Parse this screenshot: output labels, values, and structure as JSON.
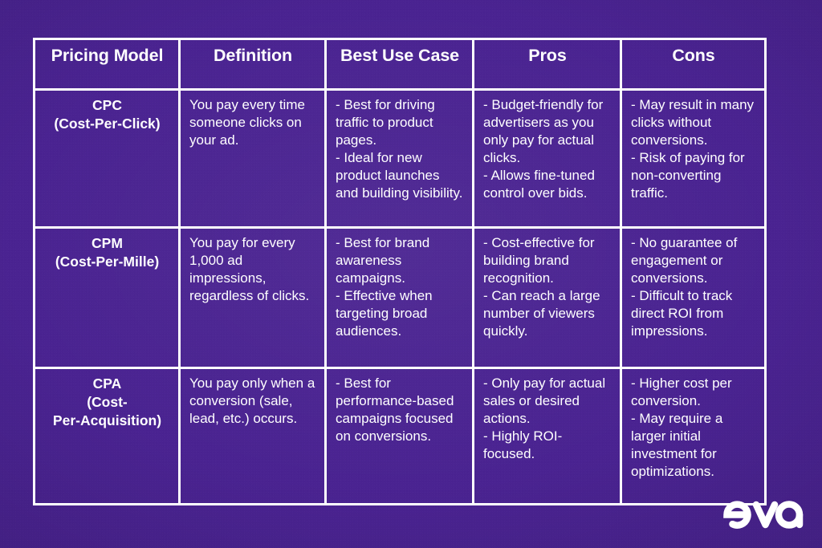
{
  "page": {
    "background_color": "#4a2391",
    "text_color": "#ffffff",
    "border_color": "#ffffff"
  },
  "table": {
    "headers": [
      "Pricing Model",
      "Definition",
      "Best Use Case",
      "Pros",
      "Cons"
    ],
    "rows": [
      {
        "model": "CPC\n(Cost-Per-Click)",
        "definition": "You pay every time someone clicks on your ad.",
        "best_use_case": "- Best for driving traffic to product pages.\n- Ideal for new product launches and building visibility.",
        "pros": "- Budget-friendly for advertisers as you only pay for actual clicks.\n- Allows fine-tuned control over bids.",
        "cons": "- May result in many clicks without conversions.\n- Risk of paying for non-converting traffic."
      },
      {
        "model": "CPM\n(Cost-Per-Mille)",
        "definition": "You pay for every 1,000 ad impressions, regardless of clicks.",
        "best_use_case": "- Best for brand awareness campaigns.\n- Effective when targeting broad audiences.",
        "pros": "- Cost-effective for building brand recognition.\n- Can reach a large number of viewers quickly.",
        "cons": "- No guarantee of engagement or conversions.\n- Difficult to track direct ROI from impressions."
      },
      {
        "model": "CPA\n(Cost-\nPer-Acquisition)",
        "definition": "You pay only when a conversion (sale, lead, etc.) occurs.",
        "best_use_case": "- Best for performance-based campaigns focused on conversions.",
        "pros": "- Only pay for actual sales or desired actions.\n- Highly ROI-focused.",
        "cons": "- Higher cost per conversion.\n- May require a larger initial investment for optimizations."
      }
    ]
  },
  "logo": {
    "name": "eva",
    "color": "#ffffff"
  }
}
